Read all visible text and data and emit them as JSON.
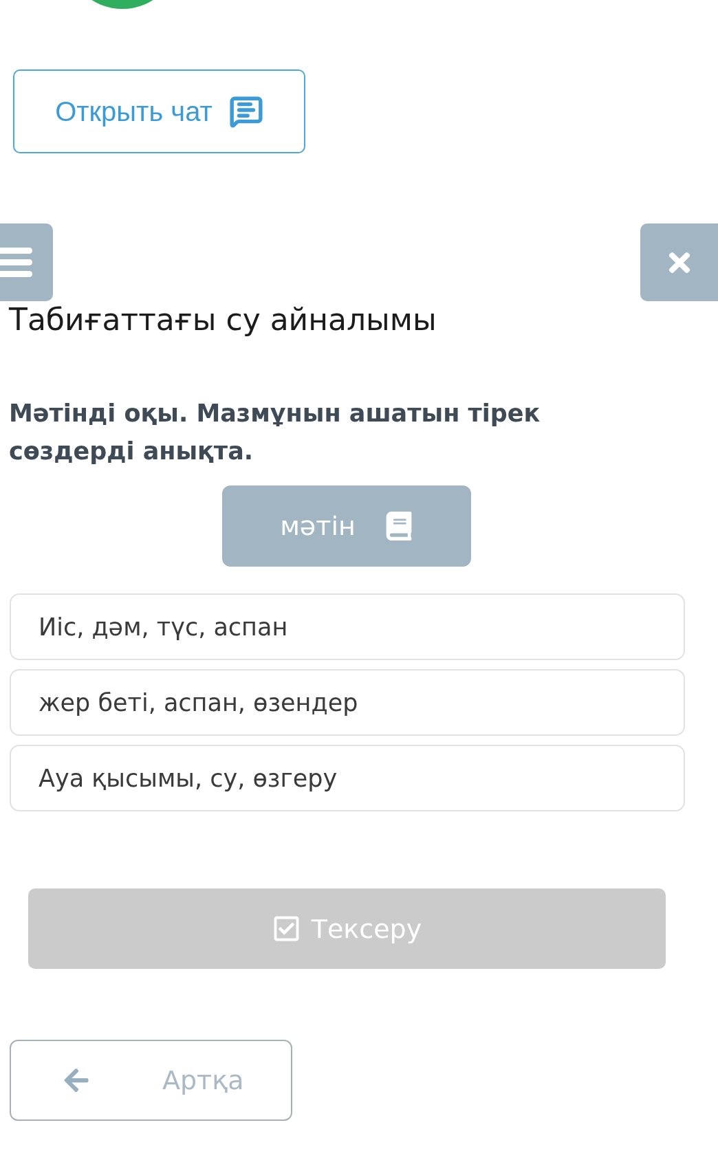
{
  "chat_button": {
    "label": "Открыть чат"
  },
  "title": "Табиғаттағы су айналымы",
  "question": "Мәтінді оқы. Мазмұнын ашатын тірек сөздерді анықта.",
  "text_button": {
    "label": "мәтін"
  },
  "options": [
    {
      "label": "Иіс, дәм, түс, аспан",
      "selected": false
    },
    {
      "label": "жер беті, аспан, өзендер",
      "selected": false
    },
    {
      "label": "Ауа қысымы, су, өзгеру",
      "selected": false
    }
  ],
  "check_button": {
    "label": "Тексеру",
    "disabled": true
  },
  "back_button": {
    "label": "Артқа"
  }
}
